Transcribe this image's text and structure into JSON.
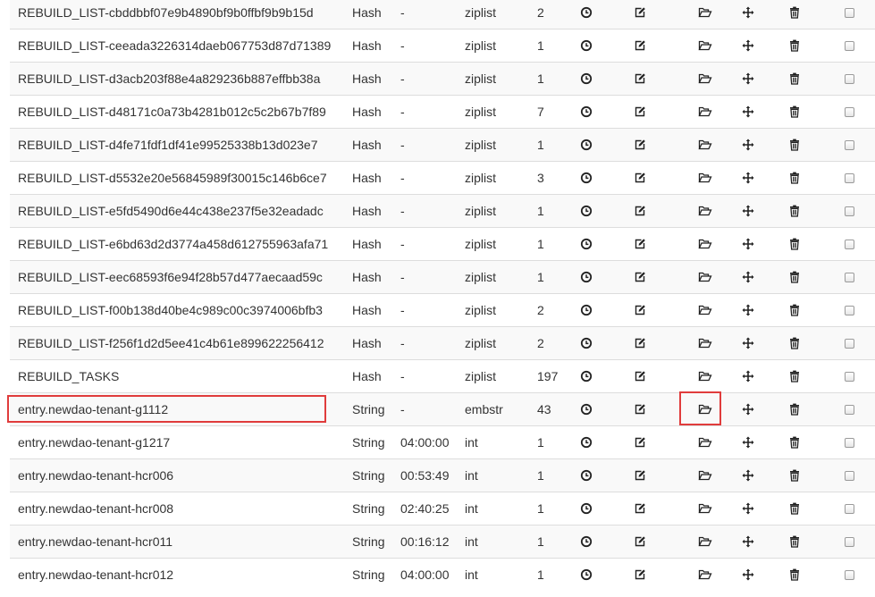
{
  "highlight_color": "#e03c3c",
  "icons": {
    "ttl": "clock-icon",
    "edit": "edit-icon",
    "open": "folder-open-icon",
    "move": "move-icon",
    "delete": "trash-icon",
    "select": "checkbox"
  },
  "rows": [
    {
      "key": "REBUILD_LIST-cbddbbf07e9b4890bf9b0ffbf9b9b15d",
      "type": "Hash",
      "ttl": "-",
      "encoding": "ziplist",
      "size": "2"
    },
    {
      "key": "REBUILD_LIST-ceeada3226314daeb067753d87d71389",
      "type": "Hash",
      "ttl": "-",
      "encoding": "ziplist",
      "size": "1"
    },
    {
      "key": "REBUILD_LIST-d3acb203f88e4a829236b887effbb38a",
      "type": "Hash",
      "ttl": "-",
      "encoding": "ziplist",
      "size": "1"
    },
    {
      "key": "REBUILD_LIST-d48171c0a73b4281b012c5c2b67b7f89",
      "type": "Hash",
      "ttl": "-",
      "encoding": "ziplist",
      "size": "7"
    },
    {
      "key": "REBUILD_LIST-d4fe71fdf1df41e99525338b13d023e7",
      "type": "Hash",
      "ttl": "-",
      "encoding": "ziplist",
      "size": "1"
    },
    {
      "key": "REBUILD_LIST-d5532e20e56845989f30015c146b6ce7",
      "type": "Hash",
      "ttl": "-",
      "encoding": "ziplist",
      "size": "3"
    },
    {
      "key": "REBUILD_LIST-e5fd5490d6e44c438e237f5e32eadadc",
      "type": "Hash",
      "ttl": "-",
      "encoding": "ziplist",
      "size": "1"
    },
    {
      "key": "REBUILD_LIST-e6bd63d2d3774a458d612755963afa71",
      "type": "Hash",
      "ttl": "-",
      "encoding": "ziplist",
      "size": "1"
    },
    {
      "key": "REBUILD_LIST-eec68593f6e94f28b57d477aecaad59c",
      "type": "Hash",
      "ttl": "-",
      "encoding": "ziplist",
      "size": "1"
    },
    {
      "key": "REBUILD_LIST-f00b138d40be4c989c00c3974006bfb3",
      "type": "Hash",
      "ttl": "-",
      "encoding": "ziplist",
      "size": "2"
    },
    {
      "key": "REBUILD_LIST-f256f1d2d5ee41c4b61e899622256412",
      "type": "Hash",
      "ttl": "-",
      "encoding": "ziplist",
      "size": "2"
    },
    {
      "key": "REBUILD_TASKS",
      "type": "Hash",
      "ttl": "-",
      "encoding": "ziplist",
      "size": "197"
    },
    {
      "key": "entry.newdao-tenant-g1112",
      "type": "String",
      "ttl": "-",
      "encoding": "embstr",
      "size": "43"
    },
    {
      "key": "entry.newdao-tenant-g1217",
      "type": "String",
      "ttl": "04:00:00",
      "encoding": "int",
      "size": "1"
    },
    {
      "key": "entry.newdao-tenant-hcr006",
      "type": "String",
      "ttl": "00:53:49",
      "encoding": "int",
      "size": "1"
    },
    {
      "key": "entry.newdao-tenant-hcr008",
      "type": "String",
      "ttl": "02:40:25",
      "encoding": "int",
      "size": "1"
    },
    {
      "key": "entry.newdao-tenant-hcr011",
      "type": "String",
      "ttl": "00:16:12",
      "encoding": "int",
      "size": "1"
    },
    {
      "key": "entry.newdao-tenant-hcr012",
      "type": "String",
      "ttl": "04:00:00",
      "encoding": "int",
      "size": "1"
    }
  ]
}
